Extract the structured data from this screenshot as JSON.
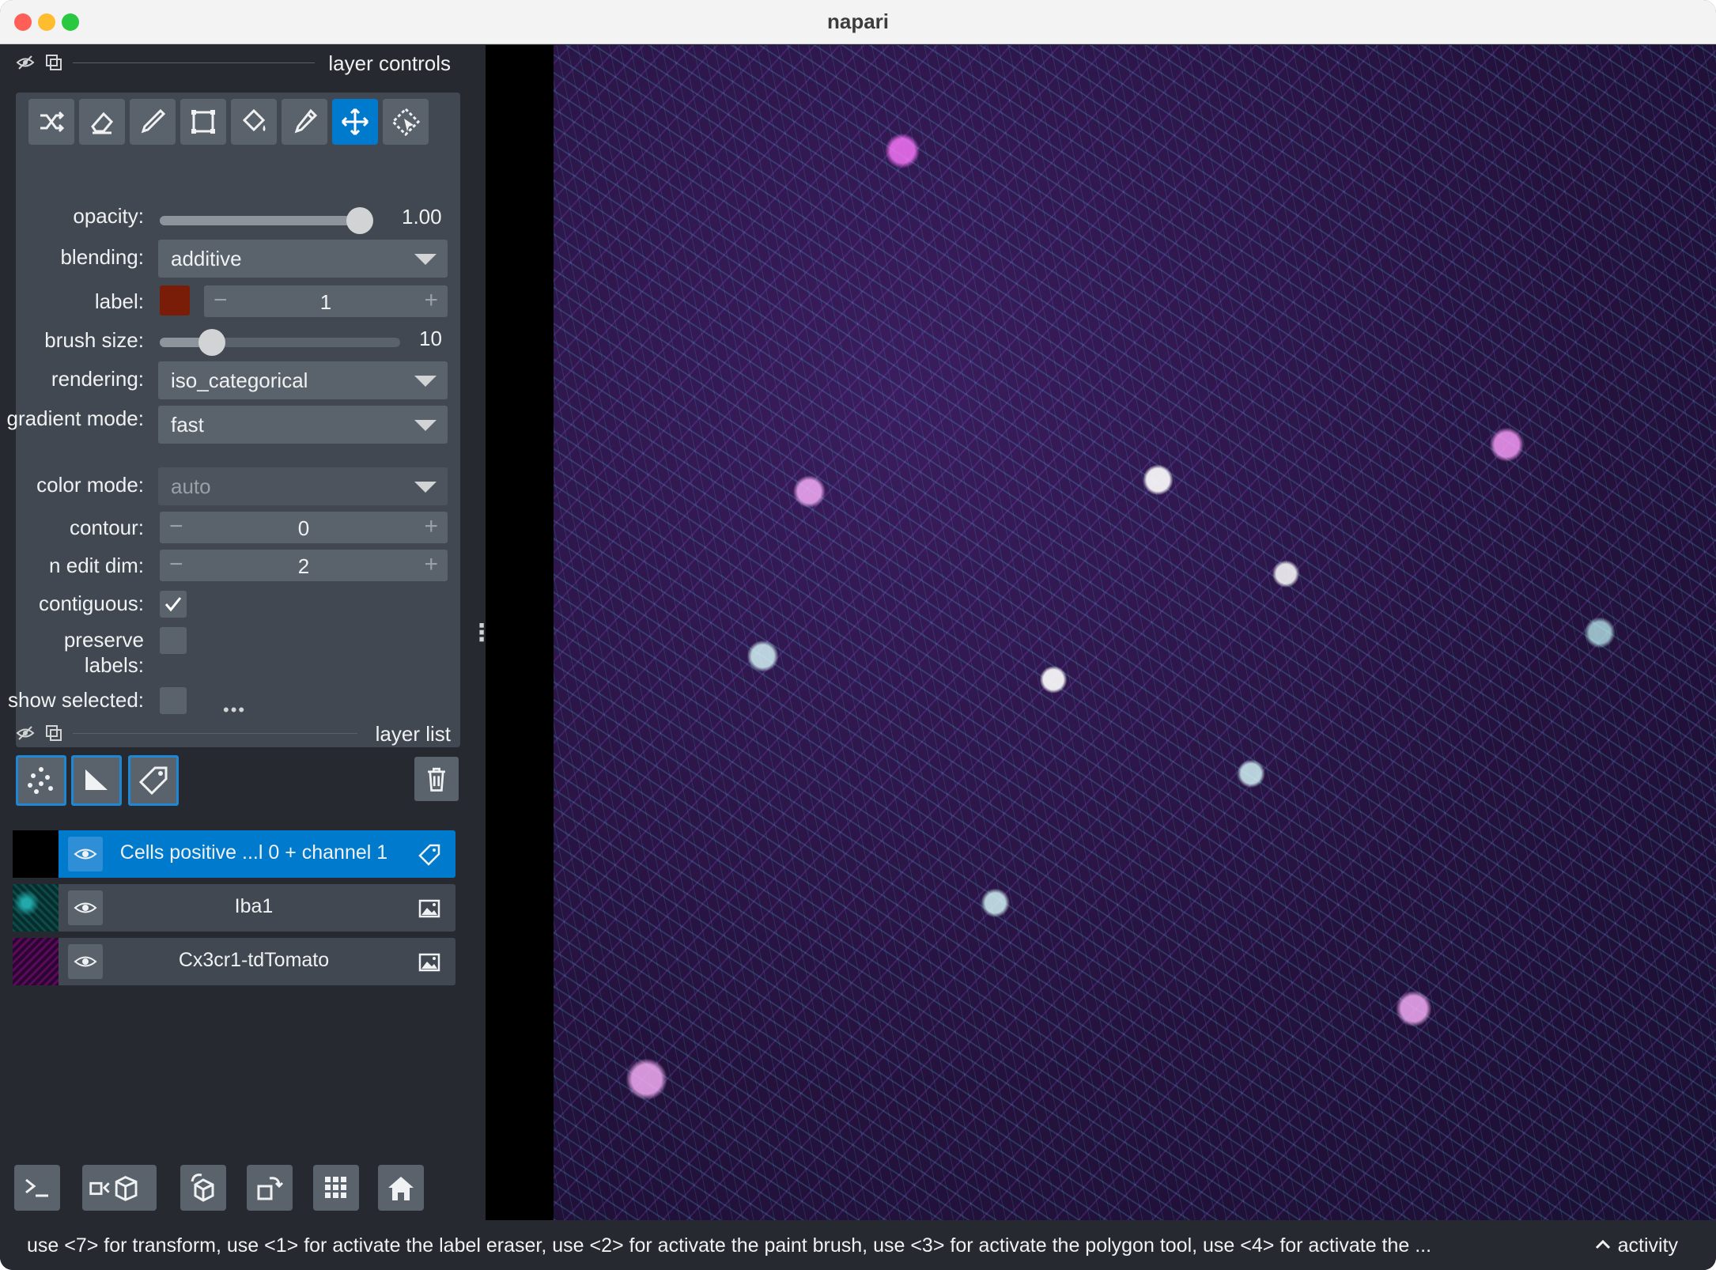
{
  "window": {
    "title": "napari"
  },
  "colors": {
    "accent": "#007acc",
    "panel_bg": "#262930",
    "control_bg": "#414851",
    "label_color": "#7a1d08",
    "traffic_close": "#ff5f57",
    "traffic_minimize": "#febc2e",
    "traffic_zoom": "#28c840"
  },
  "layer_controls": {
    "header": "layer controls",
    "tools": [
      {
        "icon": "shuffle-icon"
      },
      {
        "icon": "eraser-icon"
      },
      {
        "icon": "paint-brush-icon"
      },
      {
        "icon": "polygon-icon"
      },
      {
        "icon": "fill-bucket-icon"
      },
      {
        "icon": "color-picker-icon"
      },
      {
        "icon": "move-icon",
        "active": true
      },
      {
        "icon": "transform-icon"
      }
    ],
    "opacity": {
      "label": "opacity:",
      "value": "1.00",
      "level": 1.0
    },
    "blending": {
      "label": "blending:",
      "value": "additive"
    },
    "label": {
      "label": "label:",
      "value": "1"
    },
    "brush_size": {
      "label": "brush size:",
      "value": "10",
      "level": 0.18
    },
    "rendering": {
      "label": "rendering:",
      "value": "iso_categorical"
    },
    "gradient_mode": {
      "label": "gradient mode:",
      "value": "fast"
    },
    "color_mode": {
      "label": "color mode:",
      "value": "auto"
    },
    "contour": {
      "label": "contour:",
      "value": "0"
    },
    "n_edit_dim": {
      "label": "n edit dim:",
      "value": "2"
    },
    "contiguous": {
      "label": "contiguous:",
      "checked": true
    },
    "preserve_labels": {
      "label": "preserve labels:",
      "checked": false
    },
    "show_selected": {
      "label": "show selected:",
      "checked": false
    },
    "spin_minus": "−",
    "spin_plus": "+",
    "handle": "•••"
  },
  "layer_list": {
    "header": "layer list",
    "layers": [
      {
        "name": "Cells positive ...l 0 + channel 1",
        "type_icon": "labels-tag-icon",
        "selected": true
      },
      {
        "name": "Iba1",
        "type_icon": "image-icon",
        "selected": false
      },
      {
        "name": "Cx3cr1-tdTomato",
        "type_icon": "image-icon",
        "selected": false
      }
    ]
  },
  "bottom_buttons": [
    "console-icon",
    "ndisplay-toggle-icon",
    "roll-dims-icon",
    "transpose-icon",
    "grid-icon",
    "home-icon"
  ],
  "status": {
    "text": "use <7> for transform, use <1> for activate the label eraser, use <2> for activate the paint brush, use <3> for activate the polygon tool, use <4> for activate the ...",
    "activity": "activity",
    "activity_arrow": "^"
  },
  "splitter": "⋮"
}
